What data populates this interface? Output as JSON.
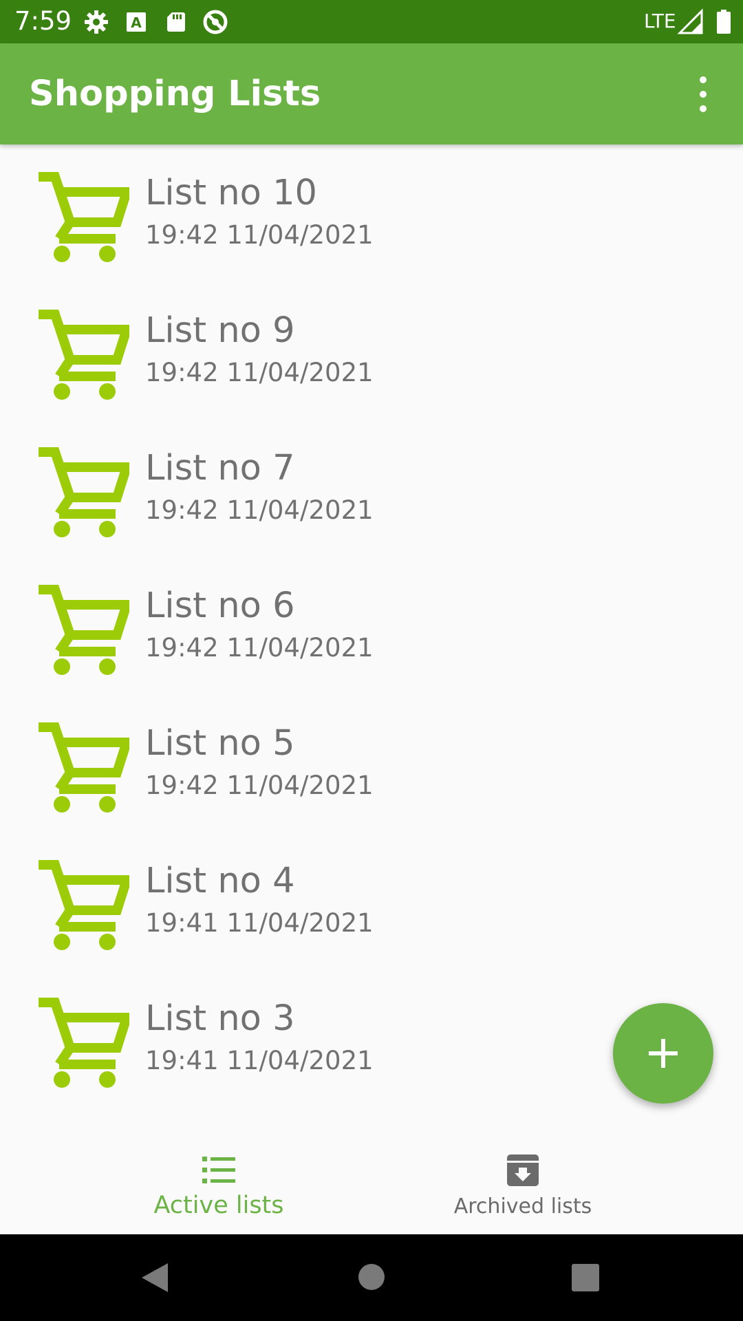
{
  "status_bar": {
    "time": "7:59",
    "network": "LTE",
    "icons": [
      "settings-icon",
      "font-icon",
      "sd-card-icon",
      "location-off-icon",
      "signal-icon",
      "battery-icon"
    ]
  },
  "app_bar": {
    "title": "Shopping Lists",
    "menu_icon": "more-vert-icon"
  },
  "colors": {
    "primary": "#6bb344",
    "primary_dark": "#38800f",
    "cart_icon": "#9ccc07",
    "text_secondary": "#717171"
  },
  "lists": [
    {
      "name": "List no 10",
      "date": "19:42 11/04/2021"
    },
    {
      "name": "List no 9",
      "date": "19:42 11/04/2021"
    },
    {
      "name": "List no 7",
      "date": "19:42 11/04/2021"
    },
    {
      "name": "List no 6",
      "date": "19:42 11/04/2021"
    },
    {
      "name": "List no 5",
      "date": "19:42 11/04/2021"
    },
    {
      "name": "List no 4",
      "date": "19:41 11/04/2021"
    },
    {
      "name": "List no 3",
      "date": "19:41 11/04/2021"
    }
  ],
  "fab": {
    "icon": "add-icon"
  },
  "bottom_nav": {
    "active": {
      "label": "Active lists",
      "icon": "list-icon"
    },
    "archived": {
      "label": "Archived lists",
      "icon": "archive-icon"
    }
  },
  "system_nav": {
    "icons": [
      "back-icon",
      "home-icon",
      "recents-icon"
    ]
  }
}
